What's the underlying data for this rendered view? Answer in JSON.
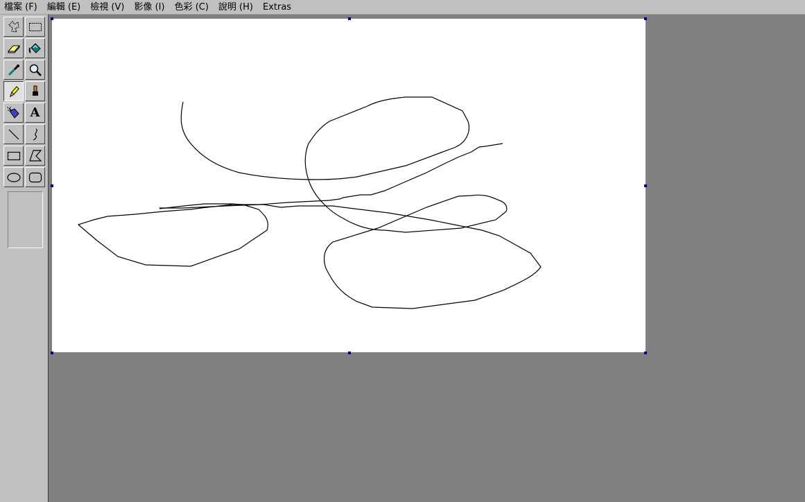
{
  "menubar": {
    "items": [
      {
        "label": "檔案 (F)"
      },
      {
        "label": "編輯 (E)"
      },
      {
        "label": "檢視 (V)"
      },
      {
        "label": "影像 (I)"
      },
      {
        "label": "色彩 (C)"
      },
      {
        "label": "說明 (H)"
      },
      {
        "label": "Extras"
      }
    ]
  },
  "toolbox": {
    "tools": [
      {
        "icon": "free-form-select-icon"
      },
      {
        "icon": "rectangle-select-icon"
      },
      {
        "icon": "eraser-icon"
      },
      {
        "icon": "fill-bucket-icon"
      },
      {
        "icon": "color-picker-icon"
      },
      {
        "icon": "magnifier-icon"
      },
      {
        "icon": "pencil-icon",
        "selected": true
      },
      {
        "icon": "brush-icon"
      },
      {
        "icon": "airbrush-icon"
      },
      {
        "icon": "text-icon",
        "glyph": "A"
      },
      {
        "icon": "line-icon"
      },
      {
        "icon": "curve-icon"
      },
      {
        "icon": "rectangle-icon"
      },
      {
        "icon": "polygon-icon"
      },
      {
        "icon": "ellipse-icon"
      },
      {
        "icon": "rounded-rectangle-icon"
      }
    ]
  },
  "canvas": {
    "background": "#ffffff",
    "stroke_color": "#000000",
    "selection_handle_color": "#00007f"
  }
}
